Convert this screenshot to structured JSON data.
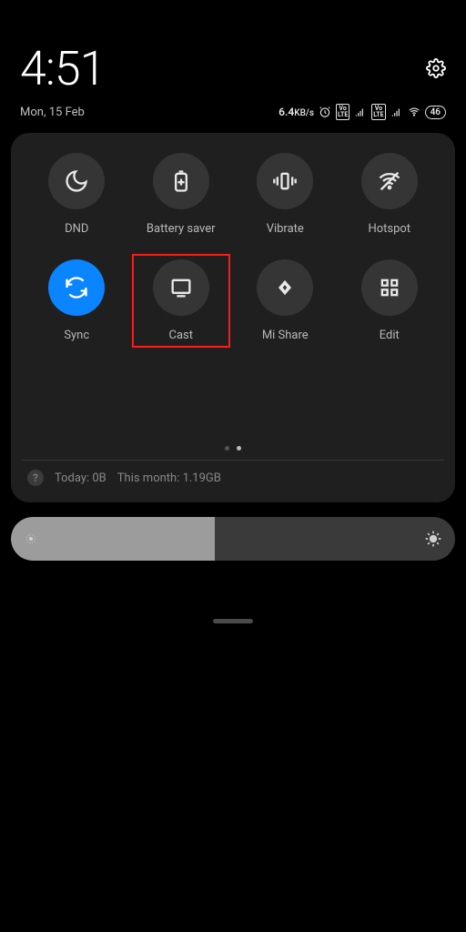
{
  "header": {
    "time": "4:51",
    "date": "Mon, 15 Feb",
    "net_speed_value": "6.4",
    "net_speed_unit": "KB/s",
    "battery_percent": "46"
  },
  "tiles": [
    {
      "id": "dnd",
      "label": "DND",
      "icon": "moon-icon",
      "active": false,
      "highlight": false
    },
    {
      "id": "battery-saver",
      "label": "Battery saver",
      "icon": "battery-plus-icon",
      "active": false,
      "highlight": false
    },
    {
      "id": "vibrate",
      "label": "Vibrate",
      "icon": "vibrate-icon",
      "active": false,
      "highlight": false
    },
    {
      "id": "hotspot",
      "label": "Hotspot",
      "icon": "hotspot-icon",
      "active": false,
      "highlight": false
    },
    {
      "id": "sync",
      "label": "Sync",
      "icon": "sync-icon",
      "active": true,
      "highlight": false
    },
    {
      "id": "cast",
      "label": "Cast",
      "icon": "cast-icon",
      "active": false,
      "highlight": true
    },
    {
      "id": "mishare",
      "label": "Mi Share",
      "icon": "mishare-icon",
      "active": false,
      "highlight": false
    },
    {
      "id": "edit",
      "label": "Edit",
      "icon": "grid-icon",
      "active": false,
      "highlight": false
    }
  ],
  "page_indicator": {
    "count": 2,
    "active_index": 1
  },
  "data_usage": {
    "today_label": "Today: 0B",
    "month_label": "This month: 1.19GB"
  },
  "brightness": {
    "percent": 46
  },
  "colors": {
    "accent": "#0a84ff",
    "highlight_border": "#ff1a1a",
    "panel_bg": "#1f1f1f"
  }
}
